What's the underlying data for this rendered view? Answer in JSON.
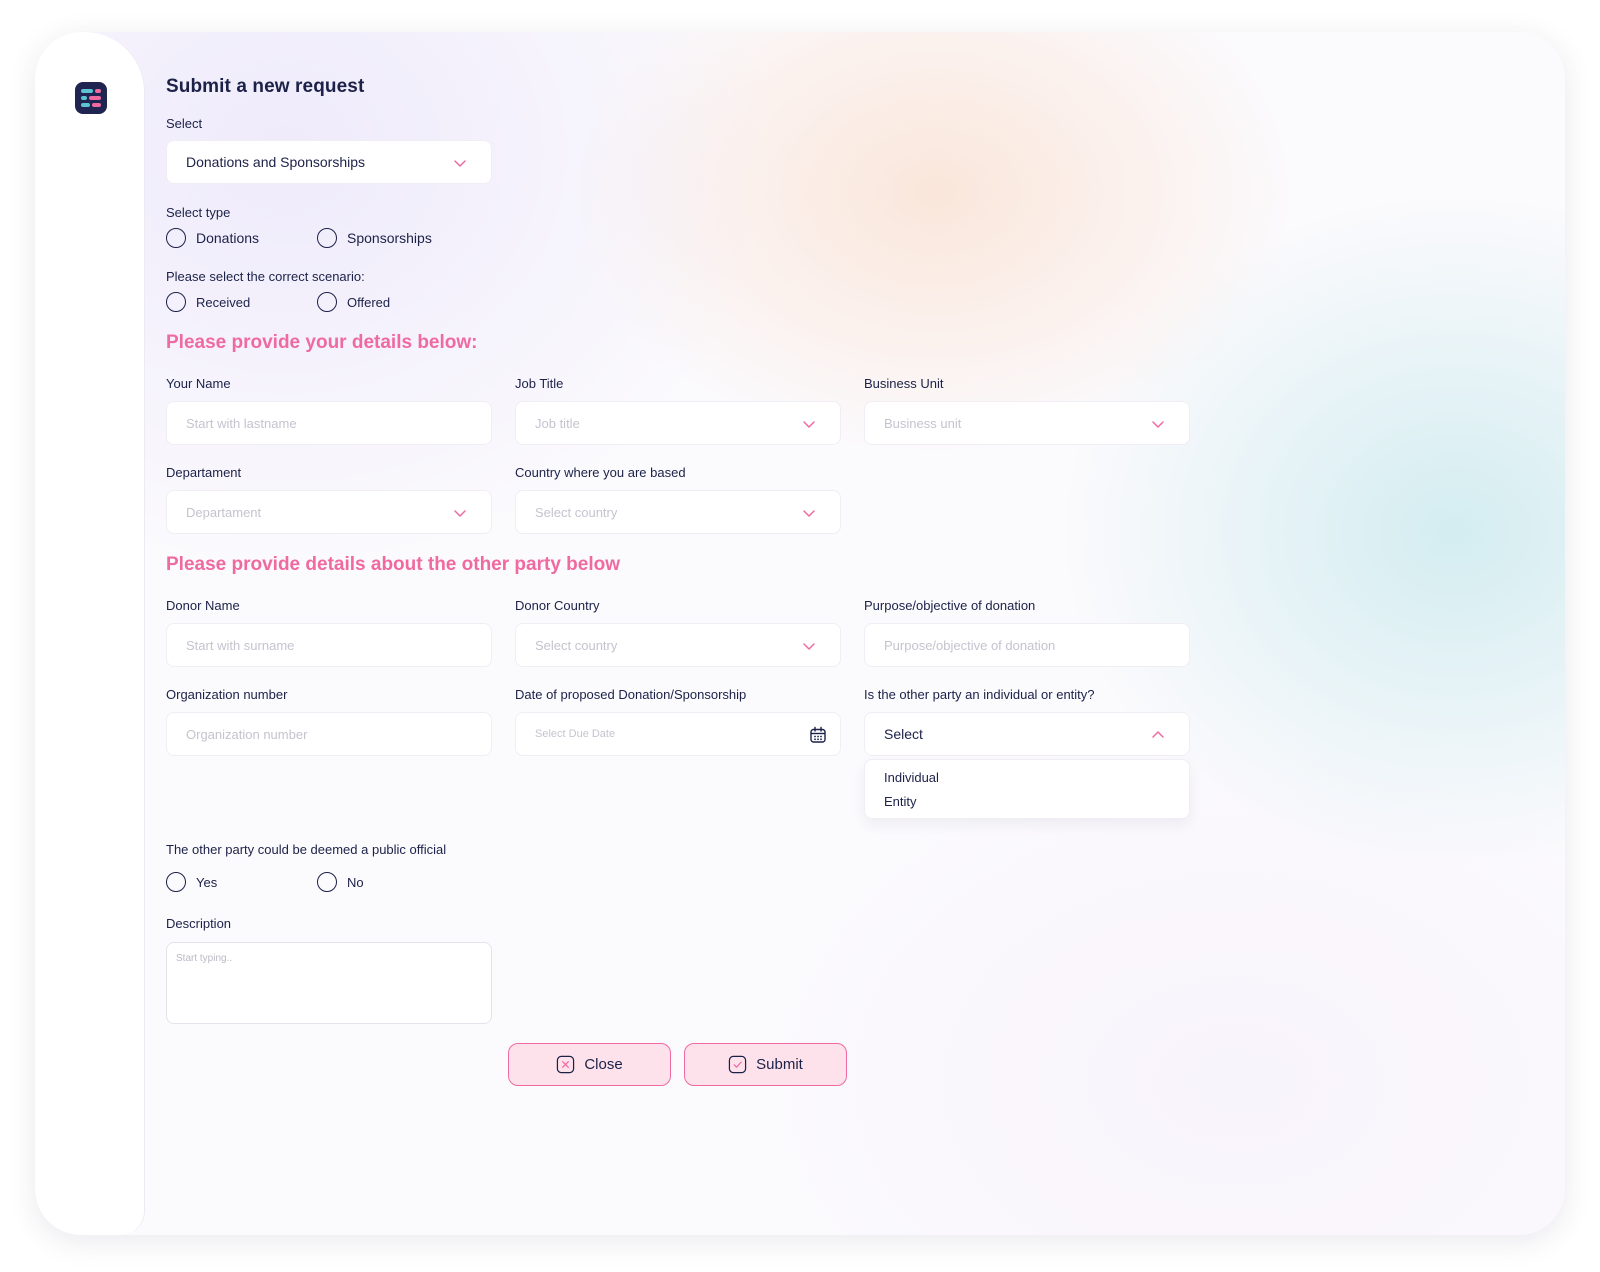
{
  "page": {
    "title": "Submit a new request"
  },
  "request_select": {
    "label": "Select",
    "value": "Donations and Sponsorships"
  },
  "select_type": {
    "label": "Select type",
    "options": [
      "Donations",
      "Sponsorships"
    ]
  },
  "scenario": {
    "label": "Please select the correct scenario:",
    "options": [
      "Received",
      "Offered"
    ]
  },
  "your_details": {
    "heading": "Please provide your details below:",
    "your_name": {
      "label": "Your Name",
      "placeholder": "Start with lastname"
    },
    "job_title": {
      "label": "Job Title",
      "placeholder": "Job title"
    },
    "business_unit": {
      "label": "Business Unit",
      "placeholder": "Business unit"
    },
    "department": {
      "label": "Departament",
      "placeholder": "Departament"
    },
    "country": {
      "label": "Country where you are based",
      "placeholder": "Select country"
    }
  },
  "other_party": {
    "heading": "Please provide details about the other party below",
    "donor_name": {
      "label": "Donor Name",
      "placeholder": "Start with surname"
    },
    "donor_country": {
      "label": "Donor Country",
      "placeholder": "Select country"
    },
    "purpose": {
      "label": "Purpose/objective of donation",
      "placeholder": "Purpose/objective of donation"
    },
    "org_number": {
      "label": "Organization number",
      "placeholder": "Organization number"
    },
    "date": {
      "label": "Date of proposed Donation/Sponsorship",
      "placeholder": "Select Due Date"
    },
    "party_type": {
      "label": "Is the other party an individual or entity?",
      "value": "Select",
      "options": [
        "Individual",
        "Entity"
      ]
    }
  },
  "public_official": {
    "label": "The other party could be deemed a public official",
    "options": [
      "Yes",
      "No"
    ]
  },
  "description": {
    "label": "Description",
    "placeholder": "Start typing.."
  },
  "actions": {
    "close_label": "Close",
    "submit_label": "Submit"
  },
  "colors": {
    "accent_pink": "#ef6aa1",
    "navy": "#1c2148",
    "button_fill": "#fde2ec"
  }
}
